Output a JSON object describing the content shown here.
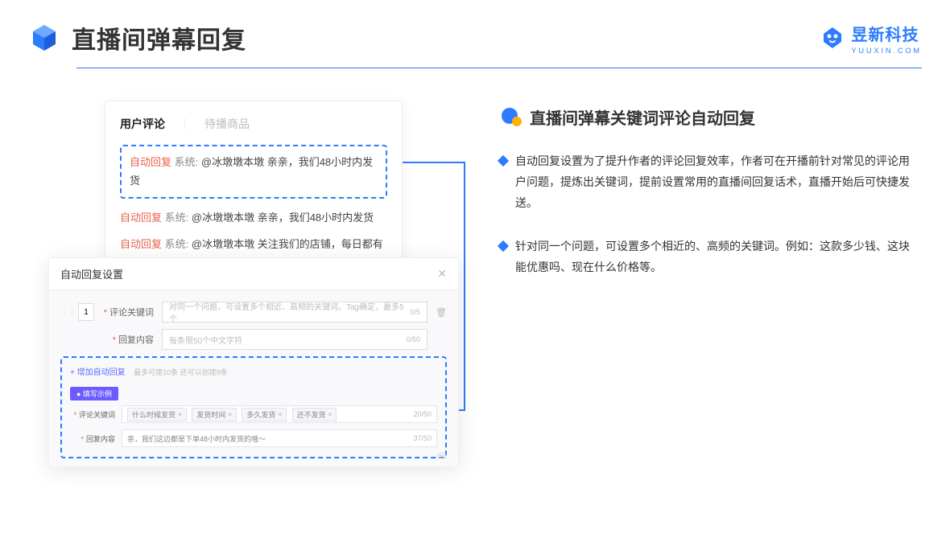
{
  "page_title": "直播间弹幕回复",
  "brand": {
    "name": "昱新科技",
    "sub": "YUUXIN.COM"
  },
  "comment_card": {
    "tab_active": "用户评论",
    "tab_inactive": "待播商品",
    "c1_tag": "自动回复",
    "c1_sys": "系统:",
    "c1_text": "@冰墩墩本墩 亲亲，我们48小时内发货",
    "c2_tag": "自动回复",
    "c2_sys": "系统:",
    "c2_text": "@冰墩墩本墩 亲亲，我们48小时内发货",
    "c3_tag": "自动回复",
    "c3_sys": "系统:",
    "c3_text": "@冰墩墩本墩 关注我们的店铺，每日都有热门推荐哟～"
  },
  "settings": {
    "title": "自动回复设置",
    "idx": "1",
    "label_keyword": "评论关键词",
    "placeholder_keyword": "对同一个问题，可设置多个相近、高频的关键词，Tag确定，最多5个",
    "counter_keyword": "0/5",
    "label_content": "回复内容",
    "placeholder_content": "每条限50个中文字符",
    "counter_content": "0/50",
    "add_link": "+ 增加自动回复",
    "hint": "最多可建10条 还可以创建9条",
    "badge": "● 填写示例",
    "ex_label_keyword": "评论关键词",
    "ex_counter_kw": "20/50",
    "ex_label_content": "回复内容",
    "ex_content_text": "亲，我们这边都是下单48小时内发货的哦～",
    "ex_counter_ct": "37/50",
    "stray_counter": "/50",
    "tags": {
      "t1": "什么时候发货",
      "t2": "发货时间",
      "t3": "多久发货",
      "t4": "还不发货"
    }
  },
  "feature": {
    "heading": "直播间弹幕关键词评论自动回复",
    "bullet1": "自动回复设置为了提升作者的评论回复效率，作者可在开播前针对常见的评论用户问题，提炼出关键词，提前设置常用的直播间回复话术，直播开始后可快捷发送。",
    "bullet2": "针对同一个问题，可设置多个相近的、高频的关键词。例如：这款多少钱、这块能优惠吗、现在什么价格等。"
  }
}
